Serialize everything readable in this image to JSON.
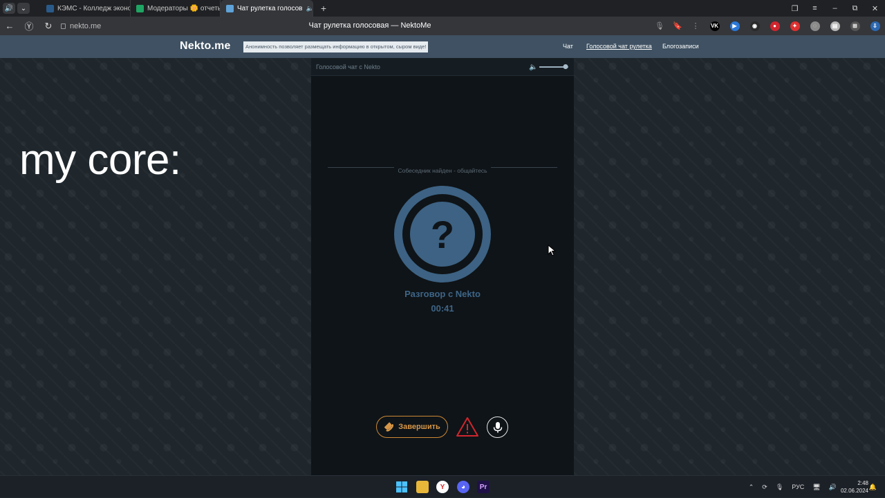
{
  "browser": {
    "tabs": [
      {
        "label": "КЭМС - Колледж эконом",
        "active": false,
        "favicon_color": "#2a5a8a"
      },
      {
        "label": "Модераторы 🌼 отчеты",
        "active": false,
        "favicon_color": "#1fa463"
      },
      {
        "label": "Чат рулетка голосов",
        "active": true,
        "favicon_color": "#5fa3d9"
      }
    ],
    "url": "nekto.me",
    "page_title": "Чат рулетка голосовая — NektoMe",
    "extensions": [
      {
        "name": "vk-icon",
        "label": "VK",
        "color": "#000000"
      },
      {
        "name": "extension-blue-icon",
        "label": "▶",
        "color": "#2b78d8"
      },
      {
        "name": "cat-extension-icon",
        "label": "◉",
        "color": "#2a2a2a"
      },
      {
        "name": "red-extension-icon",
        "label": "●",
        "color": "#d0262e"
      },
      {
        "name": "red-shield-extension-icon",
        "label": "✦",
        "color": "#e03030"
      },
      {
        "name": "globe-extension-icon",
        "label": "◌",
        "color": "#8a8a8a"
      },
      {
        "name": "wallet-extension-icon",
        "label": "▤",
        "color": "#b7b7b7"
      },
      {
        "name": "puzzle-extension-icon",
        "label": "⊞",
        "color": "#555555"
      },
      {
        "name": "download-extension-icon",
        "label": "⇩",
        "color": "#2c68b0"
      }
    ]
  },
  "site": {
    "logo": "Nekto.me",
    "notice": "Анонимность позволяет размещать информацию в открытом, сыром виде!",
    "nav": [
      {
        "label": "Чат",
        "current": false
      },
      {
        "label": "Голосовой чат рулетка",
        "current": true
      },
      {
        "label": "Блогозаписи",
        "current": false
      }
    ]
  },
  "overlay_text": "my core:",
  "chat": {
    "header_title": "Голосовой чат с Nekto",
    "volume": 0.9,
    "status": "Собеседник найден - общайтесь",
    "avatar_symbol": "?",
    "conversation_title": "Разговор с Nekto",
    "timer": "00:41",
    "end_button_label": "Завершить",
    "colors": {
      "accent_blue": "#3d6283",
      "end_orange": "#d79748",
      "warn_red": "#d0262e"
    }
  },
  "taskbar": {
    "apps": [
      "windows-start-icon",
      "file-explorer-icon",
      "yandex-browser-icon",
      "discord-icon",
      "premiere-pro-icon"
    ],
    "premiere_label": "Pr",
    "language": "РУС",
    "time": "2:48",
    "date": "02.06.2024"
  }
}
